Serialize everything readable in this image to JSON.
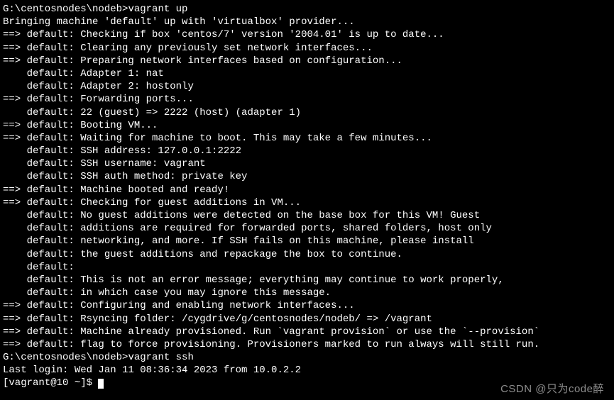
{
  "prompt1_path": "G:\\centosnodes\\nodeb>",
  "prompt1_cmd": "vagrant up",
  "lines": [
    "Bringing machine 'default' up with 'virtualbox' provider...",
    "==> default: Checking if box 'centos/7' version '2004.01' is up to date...",
    "==> default: Clearing any previously set network interfaces...",
    "==> default: Preparing network interfaces based on configuration...",
    "    default: Adapter 1: nat",
    "    default: Adapter 2: hostonly",
    "==> default: Forwarding ports...",
    "    default: 22 (guest) => 2222 (host) (adapter 1)",
    "==> default: Booting VM...",
    "==> default: Waiting for machine to boot. This may take a few minutes...",
    "    default: SSH address: 127.0.0.1:2222",
    "    default: SSH username: vagrant",
    "    default: SSH auth method: private key",
    "==> default: Machine booted and ready!",
    "==> default: Checking for guest additions in VM...",
    "    default: No guest additions were detected on the base box for this VM! Guest",
    "    default: additions are required for forwarded ports, shared folders, host only",
    "    default: networking, and more. If SSH fails on this machine, please install",
    "    default: the guest additions and repackage the box to continue.",
    "    default:",
    "    default: This is not an error message; everything may continue to work properly,",
    "    default: in which case you may ignore this message.",
    "==> default: Configuring and enabling network interfaces...",
    "==> default: Rsyncing folder: /cygdrive/g/centosnodes/nodeb/ => /vagrant",
    "==> default: Machine already provisioned. Run `vagrant provision` or use the `--provision`",
    "==> default: flag to force provisioning. Provisioners marked to run always will still run."
  ],
  "blank": "",
  "prompt2_path": "G:\\centosnodes\\nodeb>",
  "prompt2_cmd": "vagrant ssh",
  "last_login": "Last login: Wed Jan 11 08:36:34 2023 from 10.0.2.2",
  "ssh_prompt": "[vagrant@10 ~]$ ",
  "watermark": "CSDN @只为code醉"
}
